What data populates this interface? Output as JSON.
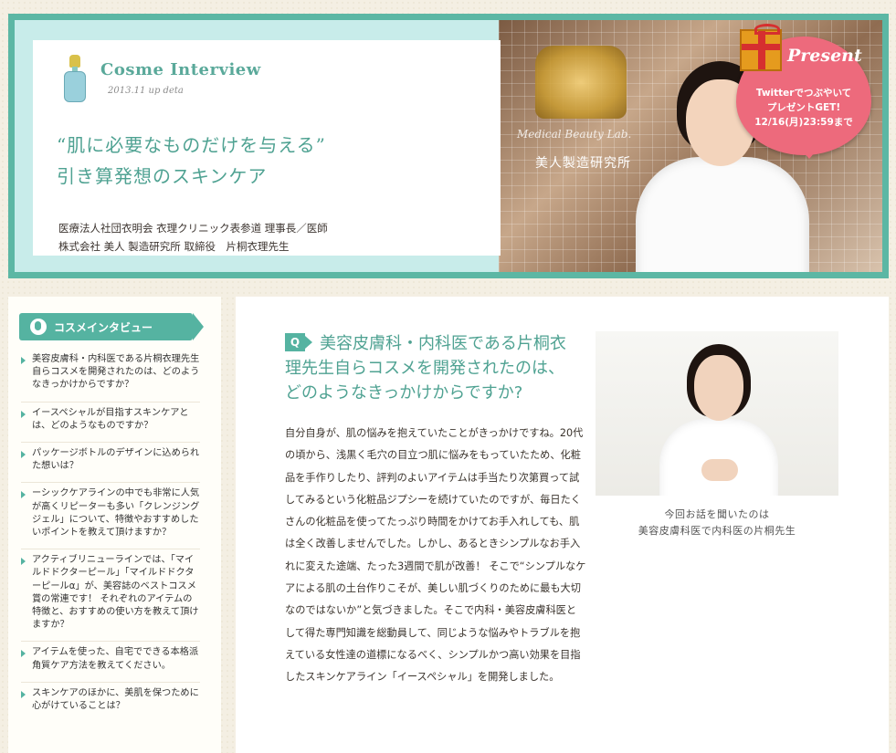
{
  "banner": {
    "title": "Cosme Interview",
    "date": "2013.11 up deta",
    "headline_line1": "“肌に必要なものだけを与える”",
    "headline_line2": "引き算発想のスキンケア",
    "credit_line1": "医療法人社団衣明会 衣理クリニック表参道 理事長／医師",
    "credit_line2": "株式会社 美人 製造研究所 取締役　片桐衣理先生",
    "photo_sign": "Medical Beauty Lab.",
    "photo_sign_jp": "美人製造研究所"
  },
  "present": {
    "title": "Present",
    "line1": "Twitterでつぶやいて",
    "line2": "プレゼントGET!",
    "line3": "12/16(月)23:59まで"
  },
  "sidebar": {
    "heading": "コスメインタビュー",
    "items": [
      "美容皮膚科・内科医である片桐衣理先生自らコスメを開発されたのは、どのようなきっかけからですか？",
      "イースペシャルが目指すスキンケアとは、どのようなものですか？",
      "パッケージボトルのデザインに込められた想いは？",
      "ーシックケアラインの中でも非常に人気が高くリピーターも多い「クレンジングジェル」について、特徴やおすすめしたいポイントを教えて頂けますか？",
      "アクティブリニューラインでは、「マイルドドクターピール」「マイルドドクターピールα」が、美容誌のベストコスメ賞の常連です！ それぞれのアイテムの特徴と、おすすめの使い方を教えて頂けますか？",
      "アイテムを使った、自宅でできる本格派角質ケア方法を教えてください。",
      "スキンケアのほかに、美肌を保つために心がけていることは？"
    ]
  },
  "main": {
    "q_label": "Q",
    "question": "美容皮膚科・内科医である片桐衣理先生自らコスメを開発されたのは、どのようなきっかけからですか?",
    "answer": "自分自身が、肌の悩みを抱えていたことがきっかけですね。20代の頃から、浅黒く毛穴の目立つ肌に悩みをもっていたため、化粧品を手作りしたり、評判のよいアイテムは手当たり次第買って試してみるという化粧品ジプシーを続けていたのですが、毎日たくさんの化粧品を使ってたっぷり時間をかけてお手入れしても、肌は全く改善しませんでした。しかし、あるときシンプルなお手入れに変えた途端、たった3週間で肌が改善！ そこで“シンプルなケアによる肌の土台作りこそが、美しい肌づくりのために最も大切なのではないか”と気づきました。そこで内科・美容皮膚科医として得た専門知識を総動員して、同じような悩みやトラブルを抱えている女性達の道標になるべく、シンプルかつ高い効果を目指したスキンケアライン「イースペシャル」を開発しました。",
    "caption_line1": "今回お話を聞いたのは",
    "caption_line2": "美容皮膚科医で内科医の片桐先生"
  },
  "colors": {
    "accent": "#55b3a1",
    "present": "#ed6a7c"
  }
}
